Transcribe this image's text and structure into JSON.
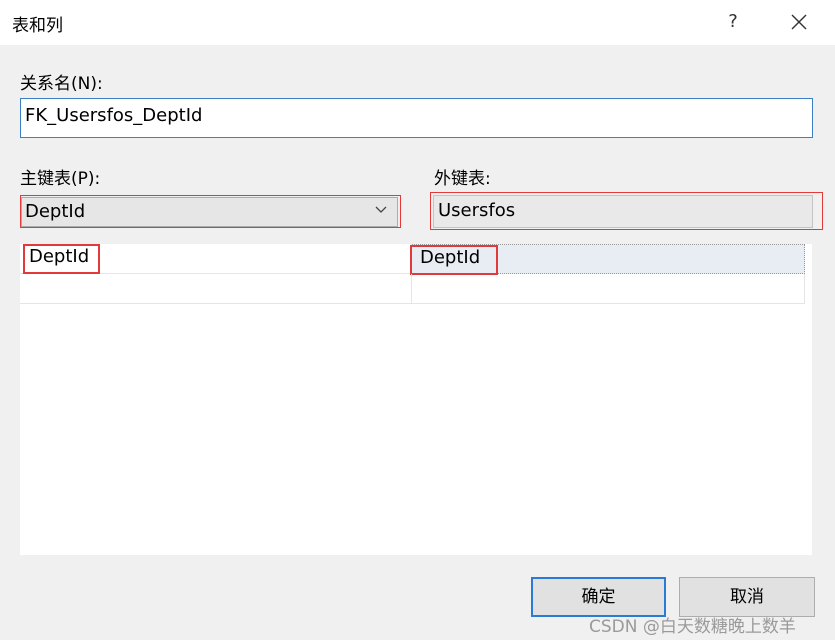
{
  "window": {
    "title": "表和列",
    "help_label": "?"
  },
  "relationship": {
    "label": "关系名(N):",
    "value": "FK_Usersfos_DeptId"
  },
  "primary_table": {
    "label": "主键表(P):",
    "selected": "DeptId"
  },
  "foreign_table": {
    "label": "外键表:",
    "value": "Usersfos"
  },
  "grid": {
    "rows": [
      {
        "pk_column": "DeptId",
        "fk_column": "DeptId"
      },
      {
        "pk_column": "",
        "fk_column": ""
      }
    ]
  },
  "buttons": {
    "ok": "确定",
    "cancel": "取消"
  },
  "watermark": "CSDN @白天数糖晚上数羊",
  "colors": {
    "highlight_red": "#e03a3a",
    "focus_blue": "#2a7bd6"
  }
}
